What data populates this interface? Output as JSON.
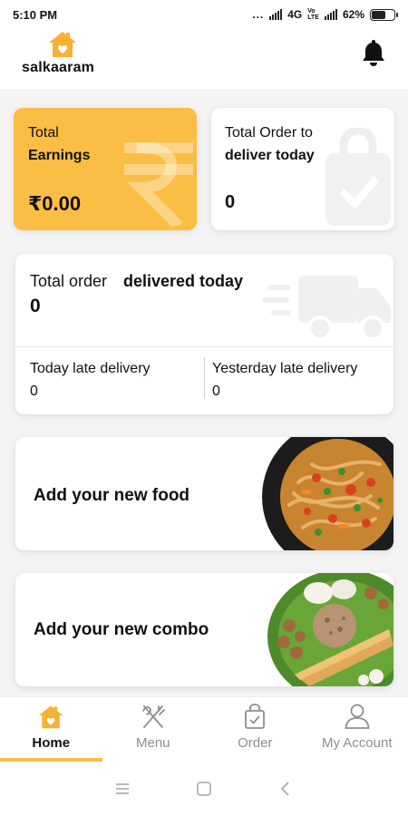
{
  "status": {
    "time": "5:10 PM",
    "dots": "...",
    "network": "4G",
    "volte_top": "Vo",
    "volte_bottom": "LTE",
    "battery": "62%",
    "battery_level": 0.62
  },
  "header": {
    "brand": "salkaaram"
  },
  "cards": {
    "earnings": {
      "label_line1": "Total",
      "label_line2": "Earnings",
      "value": "₹0.00"
    },
    "deliver_today": {
      "label_line1": "Total Order to",
      "label_line2": "deliver today",
      "value": "0"
    },
    "delivered_today": {
      "label_part1": "Total order",
      "label_part2": "delivered today",
      "value": "0",
      "today_late_label": "Today late delivery",
      "today_late_value": "0",
      "yesterday_late_label": "Yesterday late delivery",
      "yesterday_late_value": "0"
    },
    "add_food": {
      "title": "Add your new food"
    },
    "add_combo": {
      "title": "Add your new combo"
    }
  },
  "bottom_nav": {
    "items": [
      {
        "label": "Home",
        "icon": "home-icon",
        "active": true
      },
      {
        "label": "Menu",
        "icon": "fork-knife-icon",
        "active": false
      },
      {
        "label": "Order",
        "icon": "shopping-bag-icon",
        "active": false
      },
      {
        "label": "My Account",
        "icon": "user-icon",
        "active": false
      }
    ]
  },
  "colors": {
    "accent": "#fbbd44",
    "brand_orange": "#f0a426",
    "text": "#111111",
    "muted": "#8e8e8e"
  }
}
